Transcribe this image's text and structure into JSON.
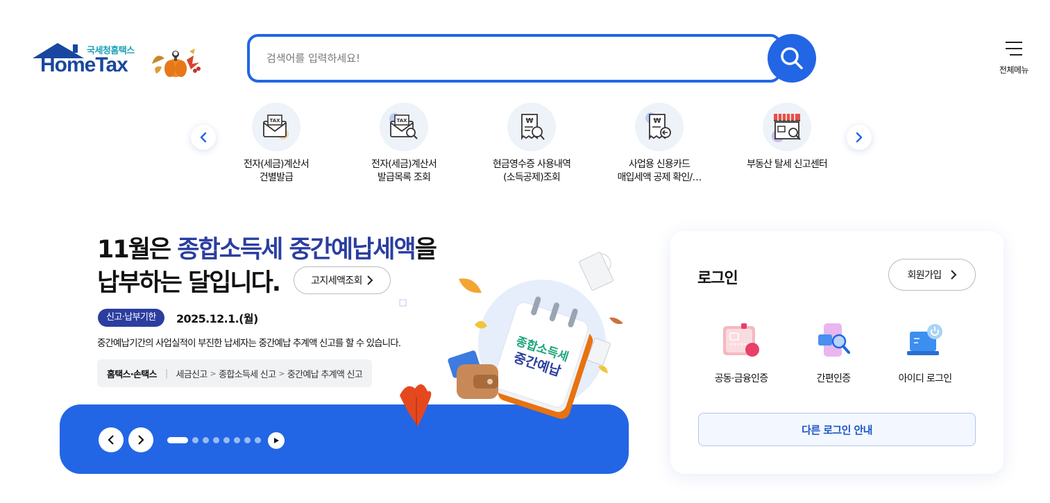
{
  "header": {
    "logo_sub": "국세청홈택스",
    "logo_main": "HomeTax",
    "search_placeholder": "검색어를 입력하세요!",
    "all_menu_label": "전체메뉴"
  },
  "quick_menu": {
    "items": [
      {
        "label": "전자(세금)계산서\n건별발급",
        "icon": "tax-invoice-envelope-icon"
      },
      {
        "label": "전자(세금)계산서\n발급목록 조회",
        "icon": "tax-invoice-search-icon"
      },
      {
        "label": "현금영수증 사용내역\n(소득공제)조회",
        "icon": "cash-receipt-search-icon"
      },
      {
        "label": "사업용 신용카드\n매입세액 공제 확인/…",
        "icon": "business-card-receipt-icon"
      },
      {
        "label": "부동산 탈세 신고센터",
        "icon": "storefront-search-icon"
      }
    ]
  },
  "banner": {
    "title_line1_pre": "11월은 ",
    "title_line1_highlight": "종합소득세 중간예납세액",
    "title_line1_post": "을",
    "title_line2": "납부하는 달입니다.",
    "notice_button": "고지세액조회",
    "badge": "신고·납부기한",
    "deadline": "2025.12.1.(월)",
    "description": "중간예납기간의 사업실적이 부진한 납세자는 중간예납 추계액 신고를 할 수 있습니다.",
    "path": {
      "site": "홈택스·손택스",
      "steps": [
        "세금신고",
        "종합소득세 신고",
        "중간예납 추계액 신고"
      ]
    },
    "calendar_text_line1": "종합소득세",
    "calendar_text_line2": "중간예납",
    "slides_total": 8,
    "slides_active": 1
  },
  "login": {
    "title": "로그인",
    "join_button": "회원가입",
    "options": [
      {
        "label": "공동·금융인증",
        "icon": "certificate-card-icon"
      },
      {
        "label": "간편인증",
        "icon": "phone-search-icon"
      },
      {
        "label": "아이디 로그인",
        "icon": "laptop-power-icon"
      }
    ],
    "other_button": "다른 로그인 안내"
  },
  "colors": {
    "primary": "#2266e5",
    "navy": "#2b3ea0",
    "logo_blue": "#19479f",
    "logo_teal": "#1a9fb8"
  }
}
